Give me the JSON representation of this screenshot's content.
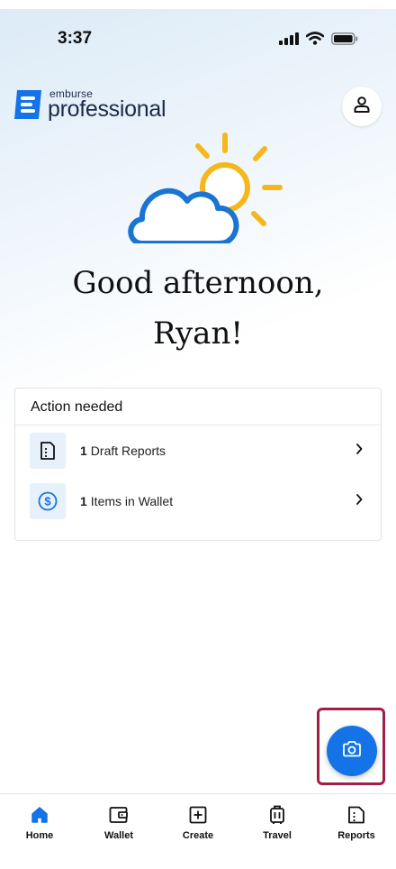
{
  "status_bar": {
    "time": "3:37"
  },
  "header": {
    "logo_small": "emburse",
    "logo_large": "professional",
    "brand_color": "#1473e6"
  },
  "greeting": {
    "line1": "Good afternoon,",
    "line2": "Ryan!"
  },
  "action_card": {
    "title": "Action needed",
    "items": [
      {
        "count": "1",
        "label": "Draft Reports",
        "icon": "report-icon"
      },
      {
        "count": "1",
        "label": "Items in Wallet",
        "icon": "dollar-icon"
      }
    ]
  },
  "fab": {
    "icon": "camera-icon",
    "color": "#1473e6",
    "highlight_color": "#a11f45"
  },
  "bottom_nav": {
    "items": [
      {
        "label": "Home",
        "icon": "home-icon",
        "active": true
      },
      {
        "label": "Wallet",
        "icon": "wallet-icon"
      },
      {
        "label": "Create",
        "icon": "plus-square-icon"
      },
      {
        "label": "Travel",
        "icon": "luggage-icon"
      },
      {
        "label": "Reports",
        "icon": "report-icon"
      }
    ]
  }
}
